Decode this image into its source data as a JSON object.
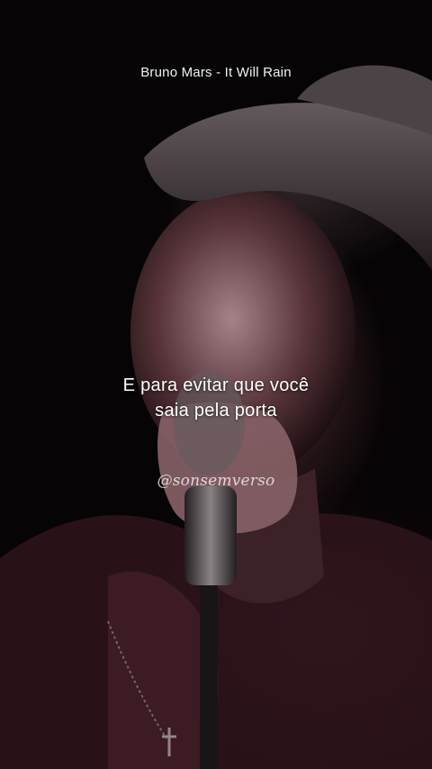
{
  "song": {
    "title": "Bruno Mars - It Will Rain"
  },
  "lyrics": {
    "line1": "E para evitar que você",
    "line2": "saia pela porta"
  },
  "watermark": {
    "handle": "@sonsemverso"
  }
}
